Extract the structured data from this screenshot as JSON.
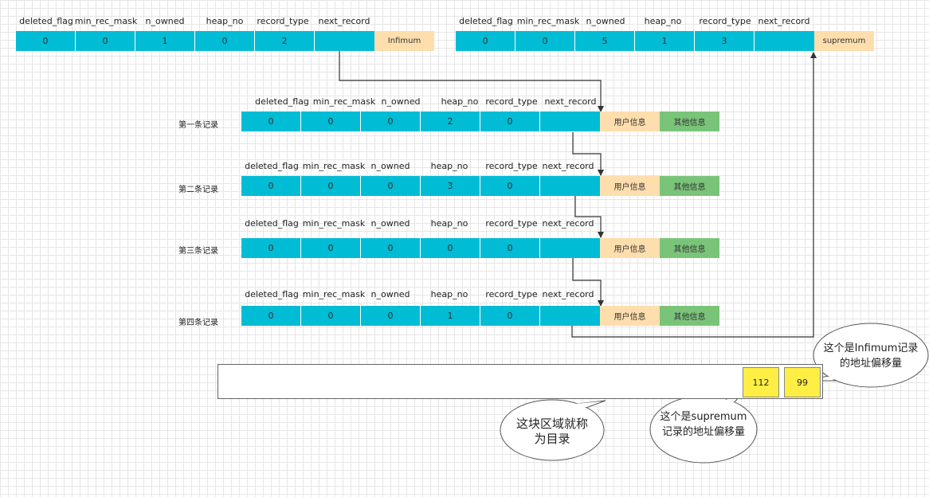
{
  "columns": [
    "deleted_flag",
    "min_rec_mask",
    "n_owned",
    "heap_no",
    "record_type",
    "next_record"
  ],
  "infimum": {
    "values": [
      "0",
      "0",
      "1",
      "0",
      "2",
      ""
    ],
    "tag": "Infimum"
  },
  "supremum": {
    "values": [
      "0",
      "0",
      "5",
      "1",
      "3",
      ""
    ],
    "tag": "supremum"
  },
  "records": [
    {
      "label": "第一条记录",
      "values": [
        "0",
        "0",
        "0",
        "2",
        "0",
        ""
      ],
      "user_info": "用户信息",
      "other_info": "其他信息"
    },
    {
      "label": "第二条记录",
      "values": [
        "0",
        "0",
        "0",
        "3",
        "0",
        ""
      ],
      "user_info": "用户信息",
      "other_info": "其他信息"
    },
    {
      "label": "第三条记录",
      "values": [
        "0",
        "0",
        "0",
        "0",
        "0",
        ""
      ],
      "user_info": "用户信息",
      "other_info": "其他信息"
    },
    {
      "label": "第四条记录",
      "values": [
        "0",
        "0",
        "0",
        "1",
        "0",
        ""
      ],
      "user_info": "用户信息",
      "other_info": "其他信息"
    }
  ],
  "directory": {
    "slots": [
      "112",
      "99"
    ]
  },
  "callouts": {
    "directory_note": "这块区域就称为目录",
    "supremum_note": "这个是supremum记录的地址偏移量",
    "infimum_note": "这个是Infimum记录的地址偏移量"
  }
}
